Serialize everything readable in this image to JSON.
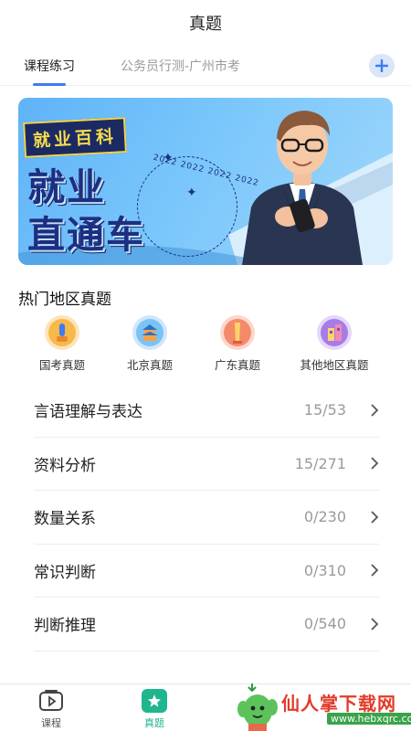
{
  "header": {
    "title": "真题"
  },
  "tabs": [
    {
      "label": "课程练习",
      "active": true
    },
    {
      "label": "公务员行测-广州市考",
      "active": false
    }
  ],
  "banner": {
    "tag": "就业百科",
    "line1": "就业",
    "line2": "直通车",
    "year_ring": "2022 2022 2022 2022"
  },
  "section": {
    "title": "热门地区真题"
  },
  "regions": [
    {
      "label": "国考真题",
      "icon": "national-exam-icon",
      "color": "#f5a623"
    },
    {
      "label": "北京真题",
      "icon": "beijing-temple-icon",
      "color": "#4aa8f0"
    },
    {
      "label": "广东真题",
      "icon": "guangdong-tower-icon",
      "color": "#f26b4f"
    },
    {
      "label": "其他地区真题",
      "icon": "other-regions-icon",
      "color": "#8e5bd9"
    }
  ],
  "subjects": [
    {
      "name": "言语理解与表达",
      "count": "15/53"
    },
    {
      "name": "资料分析",
      "count": "15/271"
    },
    {
      "name": "数量关系",
      "count": "0/230"
    },
    {
      "name": "常识判断",
      "count": "0/310"
    },
    {
      "name": "判断推理",
      "count": "0/540"
    }
  ],
  "bottom_nav": [
    {
      "label": "课程",
      "icon": "play-icon",
      "active": false
    },
    {
      "label": "真题",
      "icon": "star-icon",
      "active": true
    }
  ],
  "watermark": {
    "text": "仙人掌下载网",
    "url": "www.hebxqrc.com"
  },
  "colors": {
    "accent": "#3d7cf2",
    "active_nav": "#1fb58f",
    "muted": "#9a9a9a"
  }
}
